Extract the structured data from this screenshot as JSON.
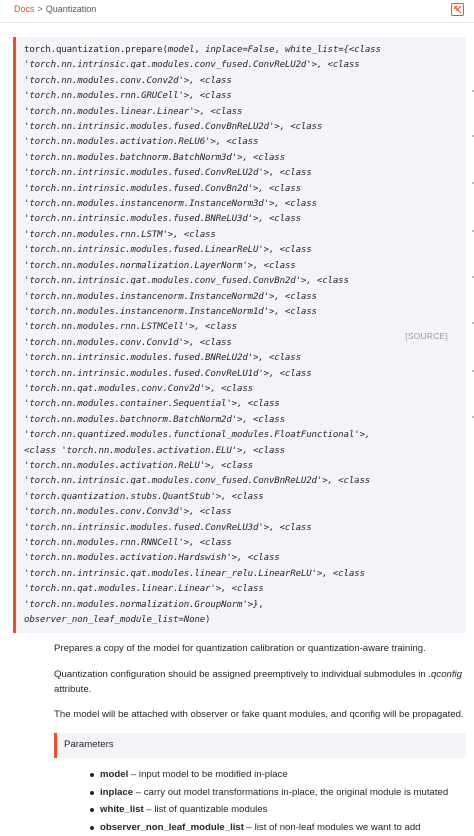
{
  "breadcrumb": {
    "root": "Docs",
    "separator": ">",
    "current": "Quantization"
  },
  "signature": {
    "lines": [
      [
        [
          "torch.quantization.prepare(",
          false
        ],
        [
          "model",
          true
        ],
        [
          ", ",
          false
        ],
        [
          "inplace=False",
          true
        ],
        [
          ", ",
          false
        ],
        [
          "white_list={<class",
          true
        ]
      ],
      [
        [
          "'torch.nn.intrinsic.qat.modules.conv_fused.ConvReLU2d'>, <class",
          true
        ]
      ],
      [
        [
          "'torch.nn.modules.conv.Conv2d'>, <class",
          true
        ]
      ],
      [
        [
          "'torch.nn.modules.rnn.GRUCell'>, <class",
          true
        ]
      ],
      [
        [
          "'torch.nn.modules.linear.Linear'>, <class",
          true
        ]
      ],
      [
        [
          "'torch.nn.intrinsic.modules.fused.ConvBnReLU2d'>, <class",
          true
        ]
      ],
      [
        [
          "'torch.nn.modules.activation.ReLU6'>, <class",
          true
        ]
      ],
      [
        [
          "'torch.nn.modules.batchnorm.BatchNorm3d'>, <class",
          true
        ]
      ],
      [
        [
          "'torch.nn.intrinsic.modules.fused.ConvReLU2d'>, <class",
          true
        ]
      ],
      [
        [
          "'torch.nn.intrinsic.modules.fused.ConvBn2d'>, <class",
          true
        ]
      ],
      [
        [
          "'torch.nn.modules.instancenorm.InstanceNorm3d'>, <class",
          true
        ]
      ],
      [
        [
          "'torch.nn.intrinsic.modules.fused.BNReLU3d'>, <class",
          true
        ]
      ],
      [
        [
          "'torch.nn.modules.rnn.LSTM'>, <class",
          true
        ]
      ],
      [
        [
          "'torch.nn.intrinsic.modules.fused.LinearReLU'>, <class",
          true
        ]
      ],
      [
        [
          "'torch.nn.modules.normalization.LayerNorm'>, <class",
          true
        ]
      ],
      [
        [
          "'torch.nn.intrinsic.qat.modules.conv_fused.ConvBn2d'>, <class",
          true
        ]
      ],
      [
        [
          "'torch.nn.modules.instancenorm.InstanceNorm2d'>, <class",
          true
        ]
      ],
      [
        [
          "'torch.nn.modules.instancenorm.InstanceNorm1d'>, <class",
          true
        ]
      ],
      [
        [
          "'torch.nn.modules.rnn.LSTMCell'>, <class",
          true
        ]
      ],
      [
        [
          "'torch.nn.modules.conv.Conv1d'>, <class",
          true
        ]
      ],
      [
        [
          "'torch.nn.intrinsic.modules.fused.BNReLU2d'>, <class",
          true
        ]
      ],
      [
        [
          "'torch.nn.intrinsic.modules.fused.ConvReLU1d'>, <class",
          true
        ]
      ],
      [
        [
          "'torch.nn.qat.modules.conv.Conv2d'>, <class",
          true
        ]
      ],
      [
        [
          "'torch.nn.modules.container.Sequential'>, <class",
          true
        ]
      ],
      [
        [
          "'torch.nn.modules.batchnorm.BatchNorm2d'>, <class",
          true
        ]
      ],
      [
        [
          "'torch.nn.quantized.modules.functional_modules.FloatFunctional'>,",
          true
        ]
      ],
      [
        [
          "<class 'torch.nn.modules.activation.ELU'>, <class",
          true
        ]
      ],
      [
        [
          "'torch.nn.modules.activation.ReLU'>, <class",
          true
        ]
      ],
      [
        [
          "'torch.nn.intrinsic.qat.modules.conv_fused.ConvBnReLU2d'>, <class",
          true
        ]
      ],
      [
        [
          "'torch.quantization.stubs.QuantStub'>, <class",
          true
        ]
      ],
      [
        [
          "'torch.nn.modules.conv.Conv3d'>, <class",
          true
        ]
      ],
      [
        [
          "'torch.nn.intrinsic.modules.fused.ConvReLU3d'>, <class",
          true
        ]
      ],
      [
        [
          "'torch.nn.modules.rnn.RNNCell'>, <class",
          true
        ]
      ],
      [
        [
          "'torch.nn.modules.activation.Hardswish'>, <class",
          true
        ]
      ],
      [
        [
          "'torch.nn.intrinsic.qat.modules.linear_relu.LinearReLU'>, <class",
          true
        ]
      ],
      [
        [
          "'torch.nn.qat.modules.linear.Linear'>, <class",
          true
        ]
      ],
      [
        [
          "'torch.nn.modules.normalization.GroupNorm'>}",
          true
        ],
        [
          ",",
          false
        ]
      ],
      [
        [
          "observer_non_leaf_module_list=None",
          true
        ],
        [
          ")",
          false
        ]
      ]
    ],
    "source_label": "[SOURCE]"
  },
  "description": {
    "p1": "Prepares a copy of the model for quantization calibration or quantization-aware training.",
    "p2_before": "Quantization configuration should be assigned preemptively to individual submodules in ",
    "p2_em": ".qconfig",
    "p2_after": "attribute.",
    "p3": "The model will be attached with observer or fake quant modules, and qconfig will be propagated."
  },
  "parameters": {
    "heading": "Parameters",
    "items": [
      {
        "name": "model",
        "sep": " – ",
        "text": "input model to be modified in-place"
      },
      {
        "name": "inplace",
        "sep": " – ",
        "text": "carry out model transformations in-place, the original module is mutated"
      },
      {
        "name": "white_list",
        "sep": " – ",
        "text": "list of quantizable modules"
      },
      {
        "name": "observer_non_leaf_module_list",
        "sep": " – ",
        "text": "list of non-leaf modules we want to add"
      }
    ]
  },
  "colors": {
    "accent": "#ee4c2c",
    "code_bg": "#f3f4f7",
    "text": "#262626",
    "muted": "#9a9a9a"
  },
  "icons": {
    "pdf": "pdf-download-icon"
  }
}
